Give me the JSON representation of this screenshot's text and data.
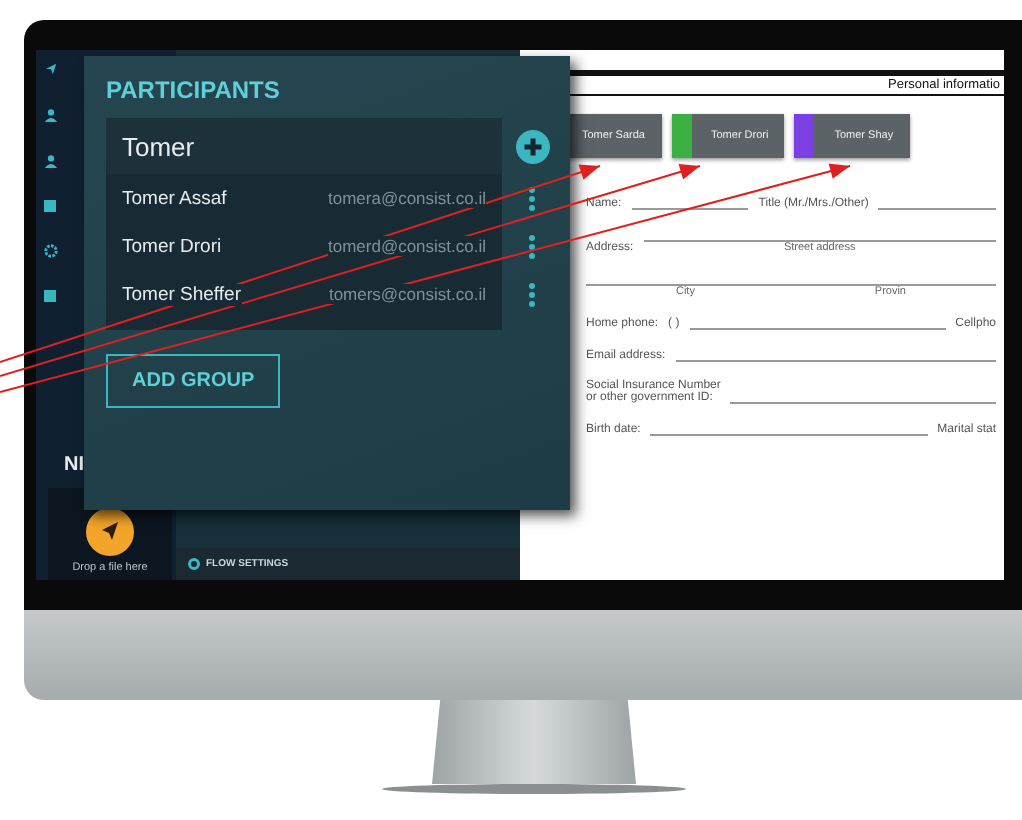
{
  "sidebar": {
    "badge_text": "NI",
    "drop_zone": {
      "label": "Drop a file here"
    }
  },
  "flow_settings": {
    "label": "FLOW SETTINGS"
  },
  "participants": {
    "title": "PARTICIPANTS",
    "search": {
      "value": "Tomer"
    },
    "rows": [
      {
        "name": "Tomer Assaf",
        "email": "tomera@consist.co.il"
      },
      {
        "name": "Tomer Drori",
        "email": "tomerd@consist.co.il"
      },
      {
        "name": "Tomer Sheffer",
        "email": "tomers@consist.co.il"
      }
    ],
    "add_button": "ADD GROUP"
  },
  "form": {
    "header": "Personal informatio",
    "chips": [
      {
        "label": "Tomer Sarda"
      },
      {
        "label": "Tomer Drori",
        "color": "#3cb043"
      },
      {
        "label": "Tomer Shay",
        "color": "#7b3fe4"
      }
    ],
    "rows": [
      {
        "items": [
          {
            "kind": "label",
            "text": "Name:"
          },
          {
            "kind": "line"
          },
          {
            "kind": "label",
            "text": "Title (Mr./Mrs./Other)"
          },
          {
            "kind": "line"
          }
        ]
      },
      {
        "items": [
          {
            "kind": "label",
            "text": "Address:"
          },
          {
            "kind": "line",
            "captions": [
              "Street address"
            ]
          }
        ]
      },
      {
        "items": [
          {
            "kind": "line",
            "captions": [
              "City",
              "Provin"
            ]
          }
        ]
      },
      {
        "items": [
          {
            "kind": "label",
            "text": "Home phone:"
          },
          {
            "kind": "label",
            "text": "(      )"
          },
          {
            "kind": "line"
          },
          {
            "kind": "label",
            "text": "Cellpho"
          }
        ]
      },
      {
        "items": [
          {
            "kind": "label",
            "text": "Email address:"
          },
          {
            "kind": "line"
          }
        ]
      },
      {
        "items": [
          {
            "kind": "label",
            "lines": [
              "Social Insurance Number",
              "or other government ID:"
            ]
          },
          {
            "kind": "line"
          }
        ]
      },
      {
        "items": [
          {
            "kind": "label",
            "text": "Birth date:"
          },
          {
            "kind": "line"
          },
          {
            "kind": "label",
            "text": "Marital stat"
          }
        ]
      }
    ]
  }
}
